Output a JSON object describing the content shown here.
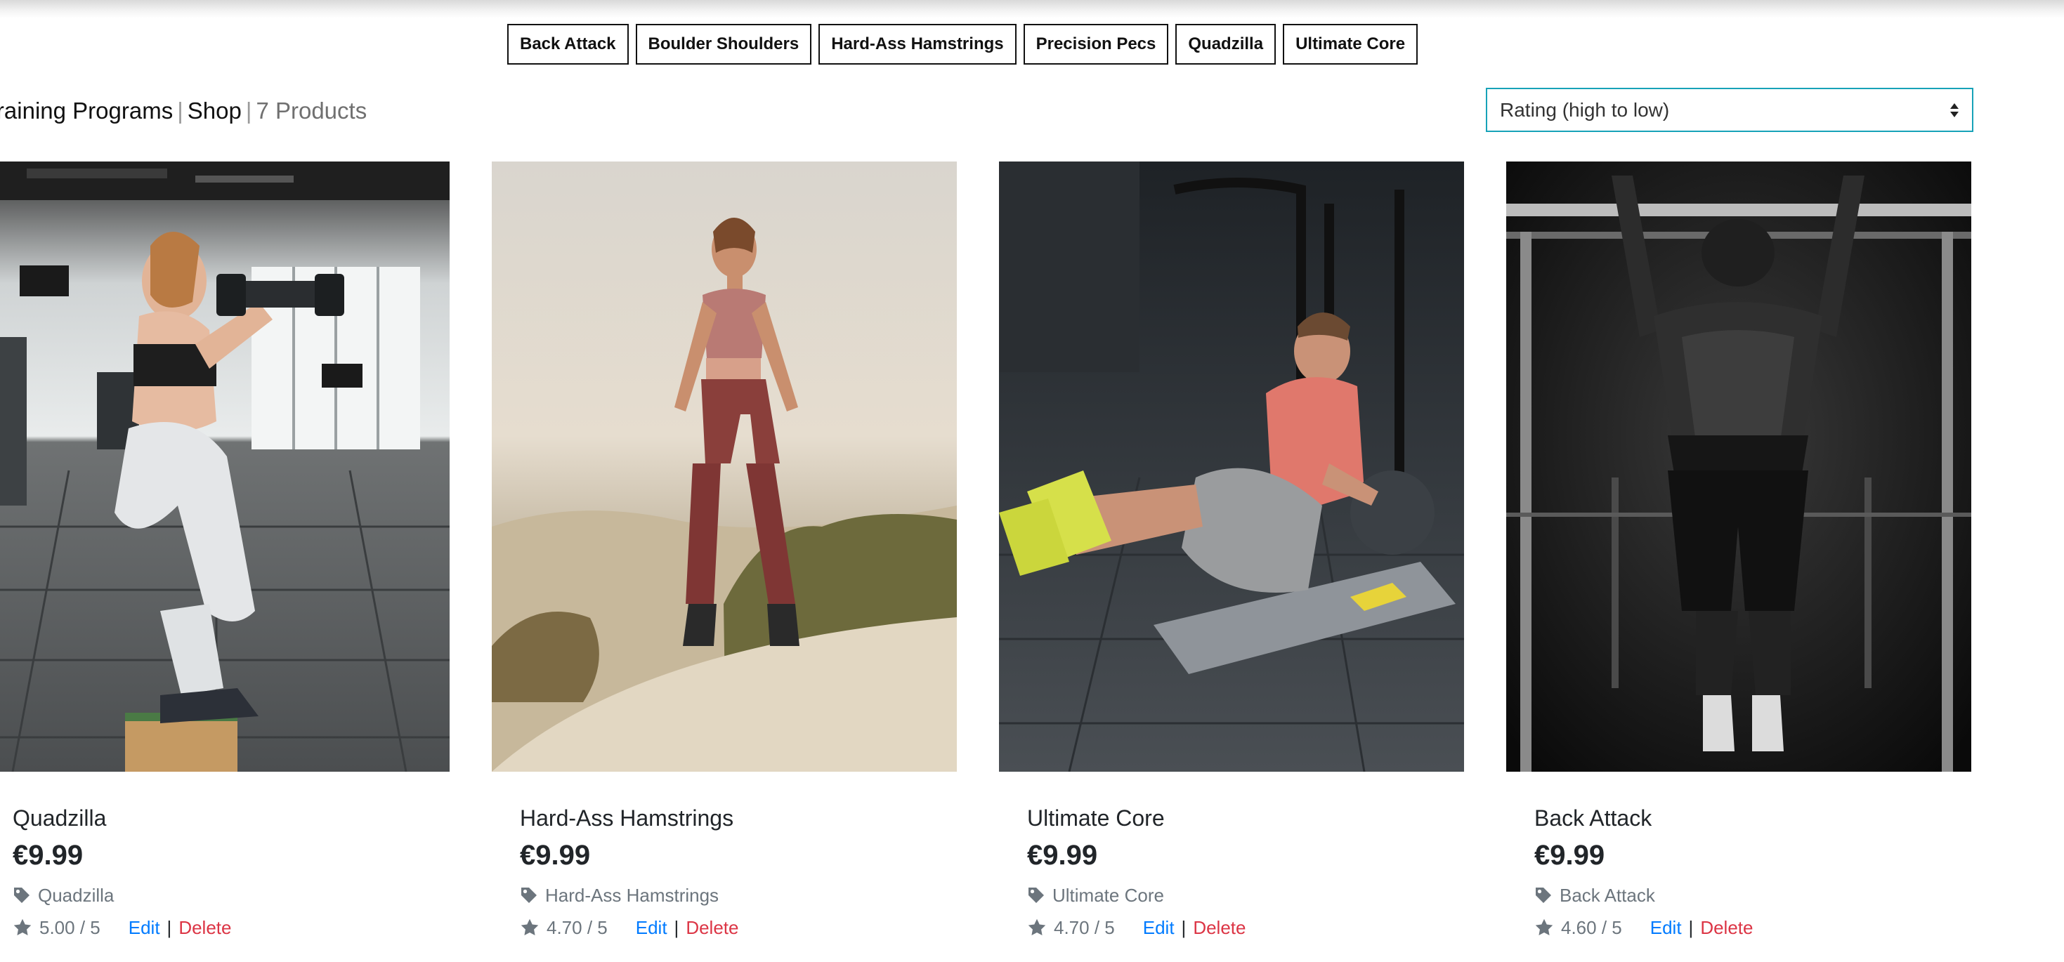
{
  "categories": [
    {
      "label": "Back Attack"
    },
    {
      "label": "Boulder Shoulders"
    },
    {
      "label": "Hard-Ass Hamstrings"
    },
    {
      "label": "Precision Pecs"
    },
    {
      "label": "Quadzilla"
    },
    {
      "label": "Ultimate Core"
    }
  ],
  "breadcrumb": {
    "part1": "Training Programs",
    "part2": "Shop",
    "count": "7 Products",
    "separator": "|"
  },
  "sort": {
    "selected": "Rating (high to low)"
  },
  "actions": {
    "edit": "Edit",
    "delete": "Delete",
    "separator": "|"
  },
  "products": [
    {
      "name": "Quadzilla",
      "price": "€9.99",
      "category": "Quadzilla",
      "rating": "5.00 / 5"
    },
    {
      "name": "Hard-Ass Hamstrings",
      "price": "€9.99",
      "category": "Hard-Ass Hamstrings",
      "rating": "4.70 / 5"
    },
    {
      "name": "Ultimate Core",
      "price": "€9.99",
      "category": "Ultimate Core",
      "rating": "4.70 / 5"
    },
    {
      "name": "Back Attack",
      "price": "€9.99",
      "category": "Back Attack",
      "rating": "4.60 / 5"
    }
  ],
  "icons": {
    "tag": "tag-icon",
    "star": "star-icon",
    "sort": "sort-arrows-icon"
  },
  "colors": {
    "edit": "#007bff",
    "delete": "#dc3545",
    "select_border": "#17a2b8"
  }
}
